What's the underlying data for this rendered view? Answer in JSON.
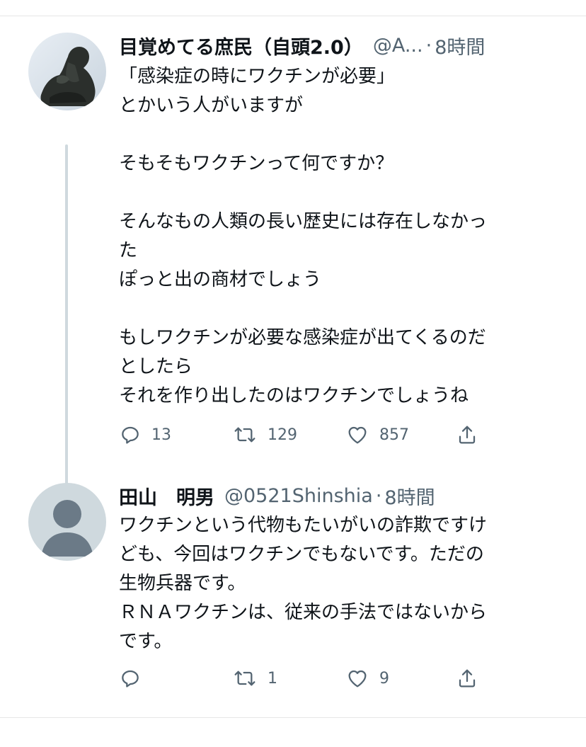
{
  "tweets": [
    {
      "name": "目覚めてる庶民（自頭2.0）",
      "handle": "@A...",
      "dot": "·",
      "time": "8時間",
      "text": "「感染症の時にワクチンが必要」\nとかいう人がいますが\n\nそもそもワクチンって何ですか？\n\nそんなもの人類の長い歴史には存在しなかっ\nた\nぽっと出の商材でしょう\n\nもしワクチンが必要な感染症が出てくるのだ\nとしたら\nそれを作り出したのはワクチンでしょうね",
      "replies": "13",
      "retweets": "129",
      "likes": "857",
      "avatar_icon": "thinker-statue-avatar"
    },
    {
      "name": "田山　明男",
      "handle": "@0521Shinshia",
      "dot": "·",
      "time": "8時間",
      "text": "ワクチンという代物もたいがいの詐欺ですけ\nども、今回はワクチンでもないです。ただの\n生物兵器です。\nＲＮＡワクチンは、従来の手法ではないから\nです。",
      "replies": "",
      "retweets": "1",
      "likes": "9",
      "avatar_icon": "default-avatar"
    }
  ],
  "icons": {
    "reply": "reply-icon",
    "retweet": "retweet-icon",
    "like": "like-icon",
    "share": "share-icon",
    "more": "more-icon"
  },
  "colors": {
    "text": "#0f1419",
    "secondary": "#536471",
    "thread_line": "#cfd9de",
    "default_avatar_bg": "#cfd9de",
    "default_avatar_fg": "#6b7a87"
  }
}
